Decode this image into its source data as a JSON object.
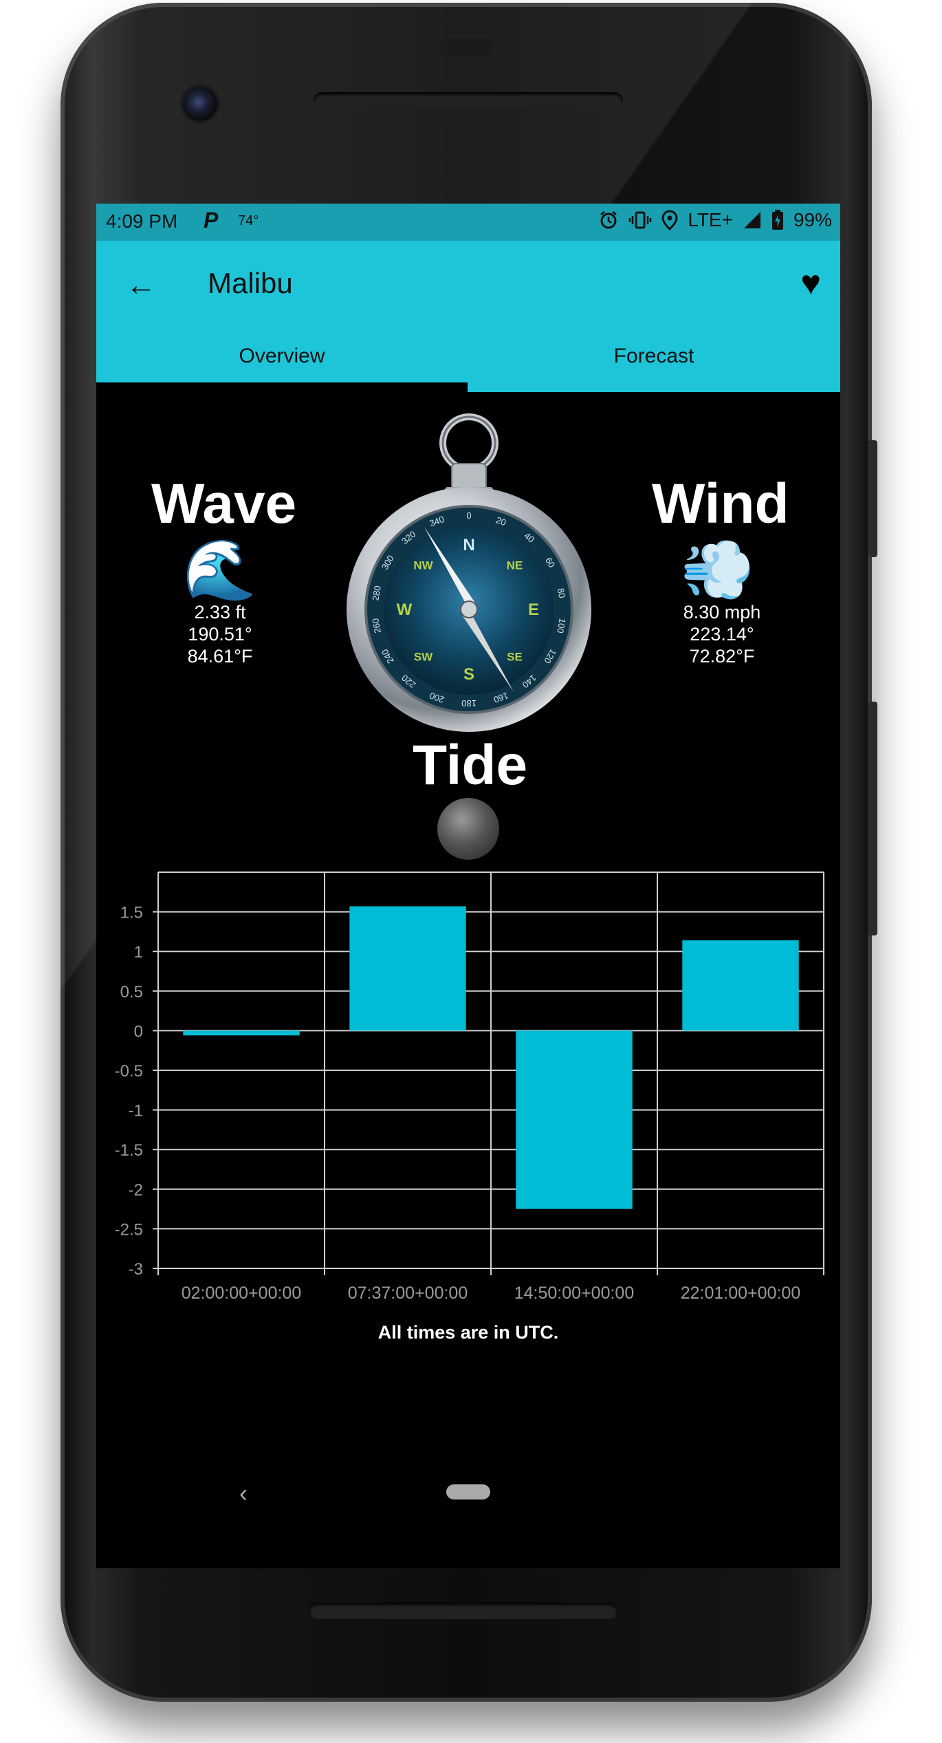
{
  "status_bar": {
    "time": "4:09 PM",
    "p_icon": "P",
    "temperature": "74°",
    "network": "LTE+",
    "battery": "99%",
    "icons": [
      "alarm-icon",
      "vibrate-icon",
      "location-icon",
      "signal-icon",
      "battery-icon"
    ]
  },
  "app_bar": {
    "title": "Malibu",
    "back_icon": "←",
    "favorite_icon": "♥",
    "color": "#1ec5d8"
  },
  "tabs": [
    {
      "label": "Overview",
      "selected": true
    },
    {
      "label": "Forecast",
      "selected": false
    }
  ],
  "wave": {
    "title": "Wave",
    "emoji": "🌊",
    "height": "2.33 ft",
    "direction": "190.51°",
    "temperature": "84.61°F"
  },
  "wind": {
    "title": "Wind",
    "emoji": "💨",
    "speed": "8.30 mph",
    "direction": "223.14°",
    "temperature": "72.82°F"
  },
  "compass": {
    "labels": [
      "N",
      "NE",
      "E",
      "SE",
      "S",
      "SW",
      "W",
      "NW"
    ],
    "degrees": [
      "0",
      "20",
      "40",
      "60",
      "80",
      "100",
      "120",
      "140",
      "160",
      "180",
      "200",
      "220",
      "240",
      "260",
      "280",
      "300",
      "320",
      "340"
    ]
  },
  "tide": {
    "title": "Tide",
    "footnote": "All times are in UTC."
  },
  "chart_data": {
    "type": "bar",
    "categories": [
      "02:00:00+00:00",
      "07:37:00+00:00",
      "14:50:00+00:00",
      "22:01:00+00:00"
    ],
    "values": [
      -0.06,
      1.57,
      -2.25,
      1.14
    ],
    "ylim": [
      -3,
      2
    ],
    "yticks": [
      1.5,
      1,
      0.5,
      0,
      -0.5,
      -1,
      -1.5,
      -2,
      -2.5,
      -3
    ],
    "ytick_labels": [
      "1.5",
      "1",
      "0.5",
      "0",
      "-0.5",
      "-1",
      "-1.5",
      "-2",
      "-2.5",
      "-3"
    ],
    "bar_color": "#00bcd4",
    "grid": true
  },
  "nav": {
    "back_icon": "‹"
  }
}
